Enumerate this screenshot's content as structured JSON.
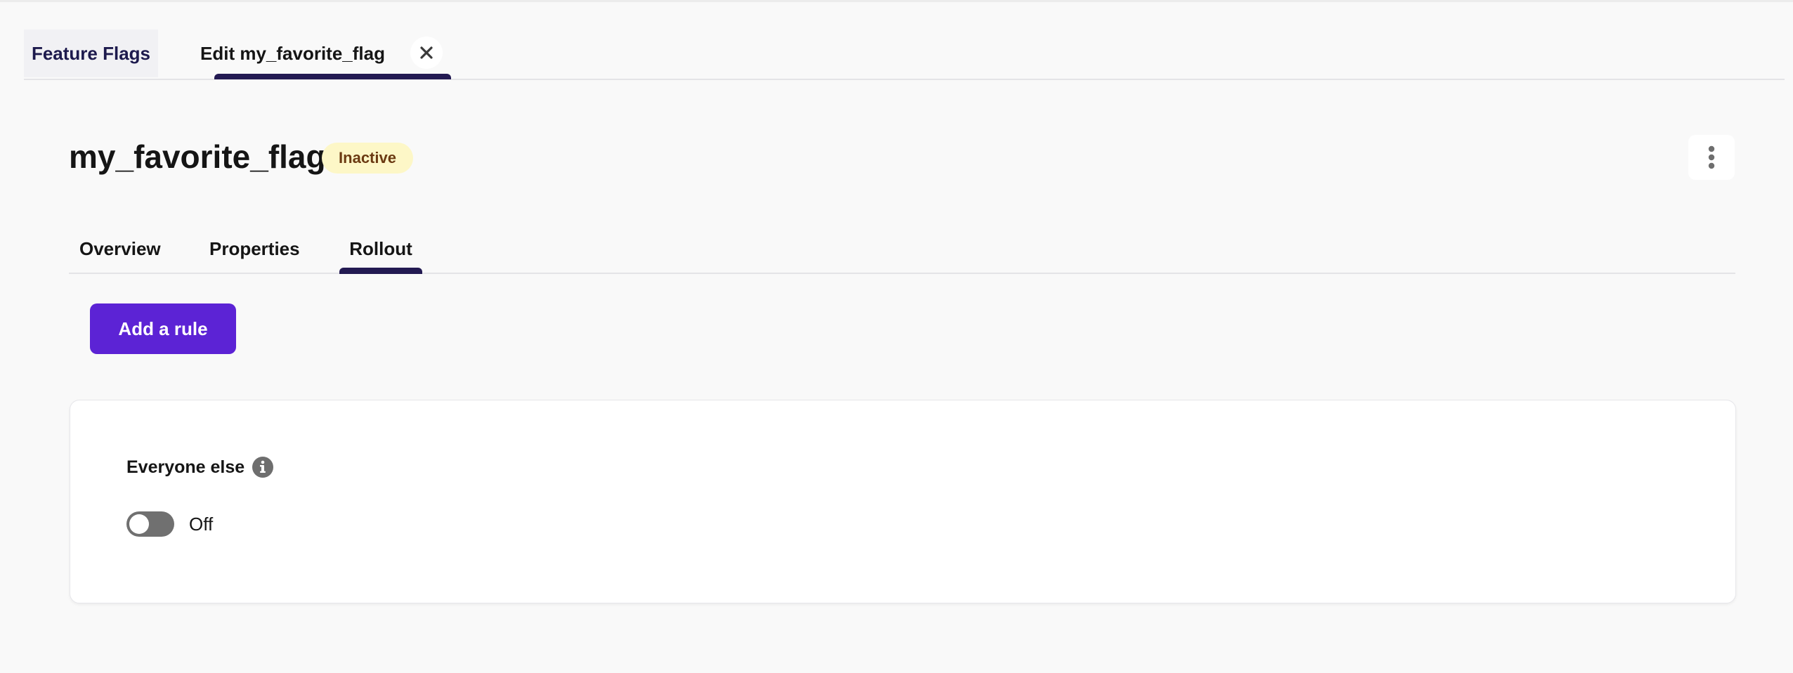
{
  "workspace_tabs": {
    "home_label": "Feature Flags",
    "edit_label": "Edit my_favorite_flag"
  },
  "flag": {
    "name": "my_favorite_flag",
    "status": "Inactive"
  },
  "subtabs": {
    "overview": "Overview",
    "properties": "Properties",
    "rollout": "Rollout",
    "active": "Rollout"
  },
  "rollout": {
    "add_rule_label": "Add a rule",
    "default_rule": {
      "title": "Everyone else",
      "toggle_state": "Off",
      "enabled": false
    }
  },
  "colors": {
    "primary": "#5c23d5",
    "nav_accent": "#231a52",
    "badge_bg": "#fdf7c7",
    "badge_text": "#6b3a12",
    "toggle_off": "#707070"
  },
  "icons": {
    "close": "close-icon",
    "more": "kebab-menu-icon",
    "info": "info-icon"
  }
}
